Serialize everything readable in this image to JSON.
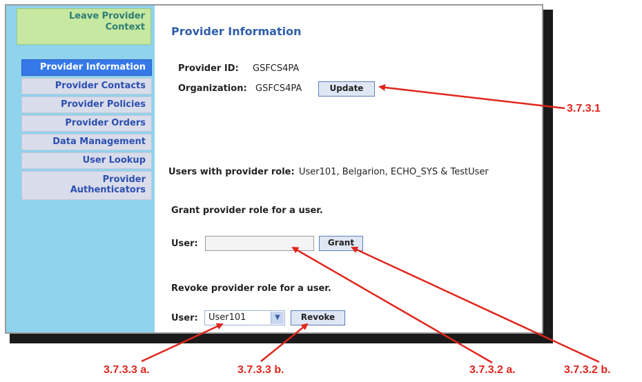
{
  "sidebar": {
    "leave_context": [
      "Leave Provider",
      "Context"
    ],
    "items": [
      {
        "label": "Provider Information",
        "active": true
      },
      {
        "label": "Provider Contacts"
      },
      {
        "label": "Provider Policies"
      },
      {
        "label": "Provider Orders"
      },
      {
        "label": "Data Management"
      },
      {
        "label": "User Lookup"
      },
      {
        "label_lines": [
          "Provider",
          "Authenticators"
        ]
      }
    ]
  },
  "main": {
    "title": "Provider Information",
    "provider_id_label": "Provider ID:",
    "provider_id_value": "GSFCS4PA",
    "organization_label": "Organization:",
    "organization_value": "GSFCS4PA",
    "update_button": "Update",
    "users_label": "Users with provider role:",
    "users_value": "User101, Belgarion, ECHO_SYS & TestUser",
    "grant_heading": "Grant provider role for a user.",
    "grant_user_label": "User:",
    "grant_user_value": "",
    "grant_button": "Grant",
    "revoke_heading": "Revoke provider role for a user.",
    "revoke_user_label": "User:",
    "revoke_selected": "User101",
    "revoke_button": "Revoke"
  },
  "annotations": {
    "a1": "3.7.3.1",
    "a2": "3.7.3.3 a.",
    "a3": "3.7.3.3 b.",
    "a4": "3.7.3.2 a.",
    "a5": "3.7.3.2 b.",
    "color": "#e0261c"
  },
  "colors": {
    "sidebar_bg": "#8fd3ec",
    "leave_bg": "#c6e8a0",
    "nav_active": "#3579e8",
    "nav_link": "#2c4fb0",
    "title": "#2f5faa"
  }
}
